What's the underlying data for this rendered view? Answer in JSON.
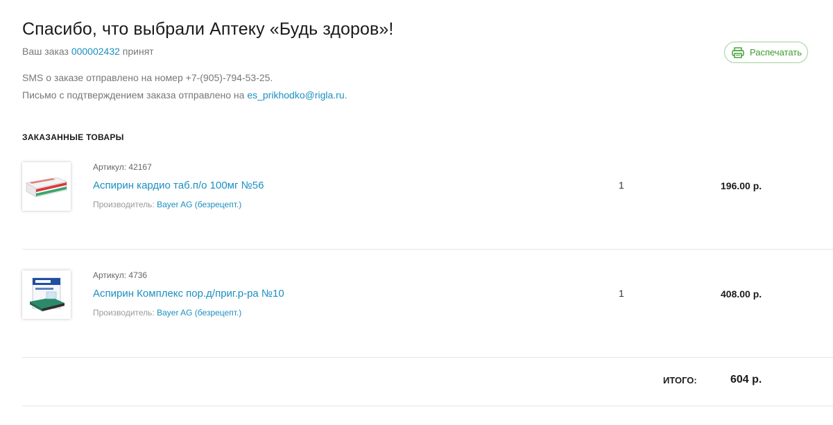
{
  "header": {
    "title": "Спасибо, что выбрали Аптеку «Будь здоров»!",
    "order_prefix": "Ваш заказ",
    "order_number": "000002432",
    "order_suffix": "принят",
    "print_label": "Распечатать"
  },
  "notice": {
    "sms_text": "SMS о заказе отправлено на номер +7-(905)-794-53-25.",
    "email_prefix": "Письмо с подтверждением заказа отправлено на",
    "email": "es_prikhodko@rigla.ru",
    "email_suffix": "."
  },
  "section_title": "ЗАКАЗАННЫЕ ТОВАРЫ",
  "items": [
    {
      "sku": "Артикул: 42167",
      "name": "Аспирин кардио таб.п/о 100мг №56",
      "maker_label": "Производитель:",
      "maker": "Bayer AG (безрецепт.)",
      "qty": "1",
      "price": "196.00 р."
    },
    {
      "sku": "Артикул: 4736",
      "name": "Аспирин Комплекс пор.д/приг.р-ра №10",
      "maker_label": "Производитель:",
      "maker": "Bayer AG (безрецепт.)",
      "qty": "1",
      "price": "408.00 р."
    }
  ],
  "total": {
    "label": "ИТОГО:",
    "value": "604 р."
  },
  "colors": {
    "link": "#1a8fc0",
    "print_green": "#3a9b2e",
    "print_border": "#9fd09a"
  }
}
